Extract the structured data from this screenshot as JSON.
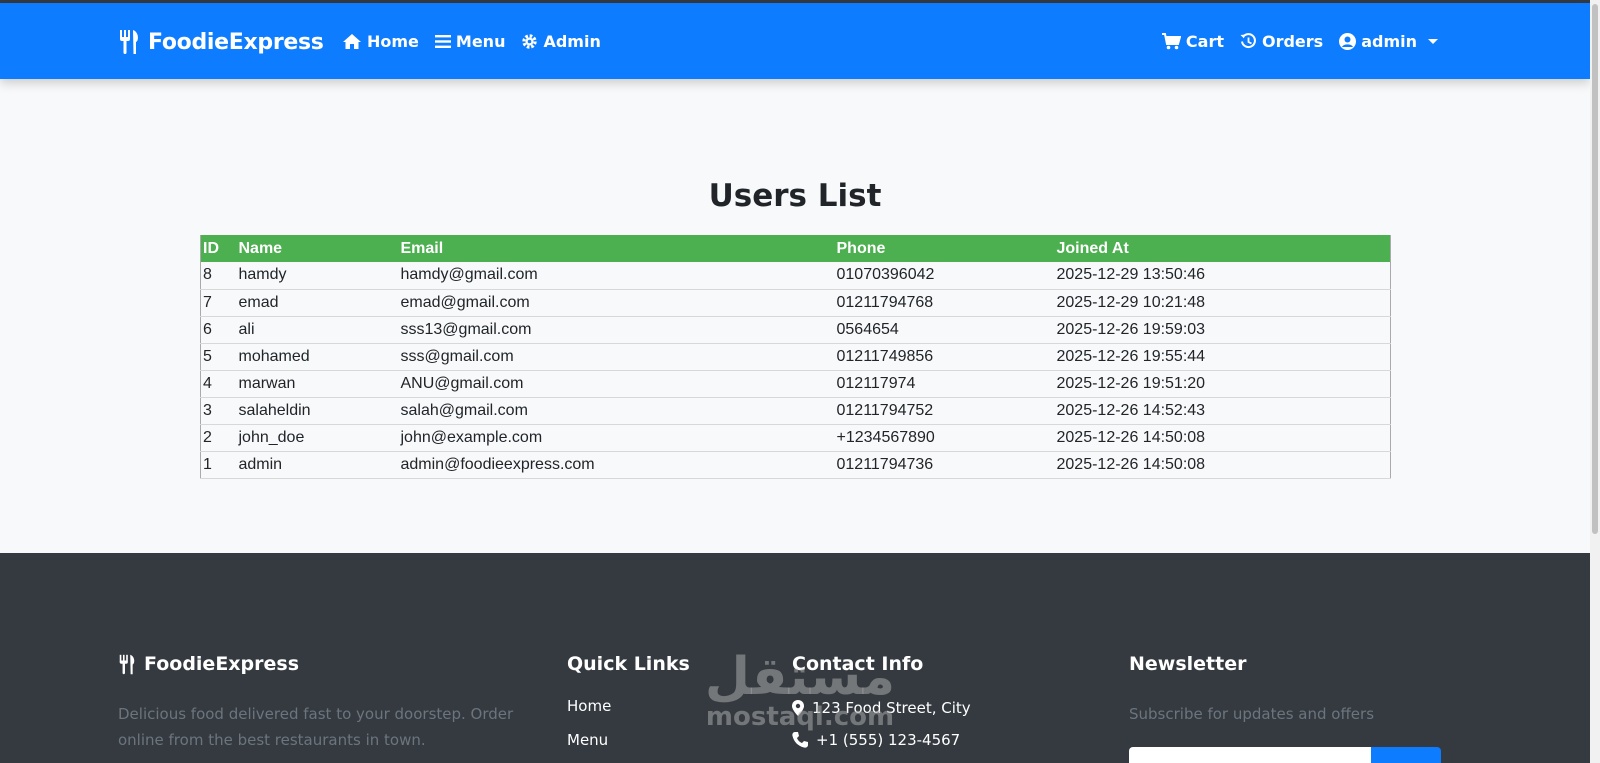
{
  "navbar": {
    "brand": "FoodieExpress",
    "links": [
      {
        "label": "Home",
        "icon": "home-icon"
      },
      {
        "label": "Menu",
        "icon": "bars-icon"
      },
      {
        "label": "Admin",
        "icon": "gear-icon"
      }
    ],
    "right": [
      {
        "label": "Cart",
        "icon": "cart-icon"
      },
      {
        "label": "Orders",
        "icon": "history-icon"
      },
      {
        "label": "admin",
        "icon": "user-circle-icon"
      }
    ]
  },
  "main": {
    "title": "Users List",
    "columns": [
      "ID",
      "Name",
      "Email",
      "Phone",
      "Joined At"
    ],
    "rows": [
      [
        "8",
        "hamdy",
        "hamdy@gmail.com",
        "01070396042",
        "2025-12-29 13:50:46"
      ],
      [
        "7",
        "emad",
        "emad@gmail.com",
        "01211794768",
        "2025-12-29 10:21:48"
      ],
      [
        "6",
        "ali",
        "sss13@gmail.com",
        "0564654",
        "2025-12-26 19:59:03"
      ],
      [
        "5",
        "mohamed",
        "sss@gmail.com",
        "01211749856",
        "2025-12-26 19:55:44"
      ],
      [
        "4",
        "marwan",
        "ANU@gmail.com",
        "012117974",
        "2025-12-26 19:51:20"
      ],
      [
        "3",
        "salaheldin",
        "salah@gmail.com",
        "01211794752",
        "2025-12-26 14:52:43"
      ],
      [
        "2",
        "john_doe",
        "john@example.com",
        "+1234567890",
        "2025-12-26 14:50:08"
      ],
      [
        "1",
        "admin",
        "admin@foodieexpress.com",
        "01211794736",
        "2025-12-26 14:50:08"
      ]
    ]
  },
  "footer": {
    "brand": "FoodieExpress",
    "about": "Delicious food delivered fast to your doorstep. Order online from the best restaurants in town.",
    "quick_links_title": "Quick Links",
    "quick_links": [
      "Home",
      "Menu"
    ],
    "contact_title": "Contact Info",
    "contact": [
      "123 Food Street, City",
      "+1 (555) 123-4567"
    ],
    "newsletter_title": "Newsletter",
    "newsletter_text": "Subscribe for updates and offers"
  },
  "watermark": {
    "arabic": "مستقل",
    "latin": "mostaql.com"
  },
  "colors": {
    "primary": "#0d7cff",
    "table_header": "#4caf50",
    "footer_bg": "#343a40"
  }
}
